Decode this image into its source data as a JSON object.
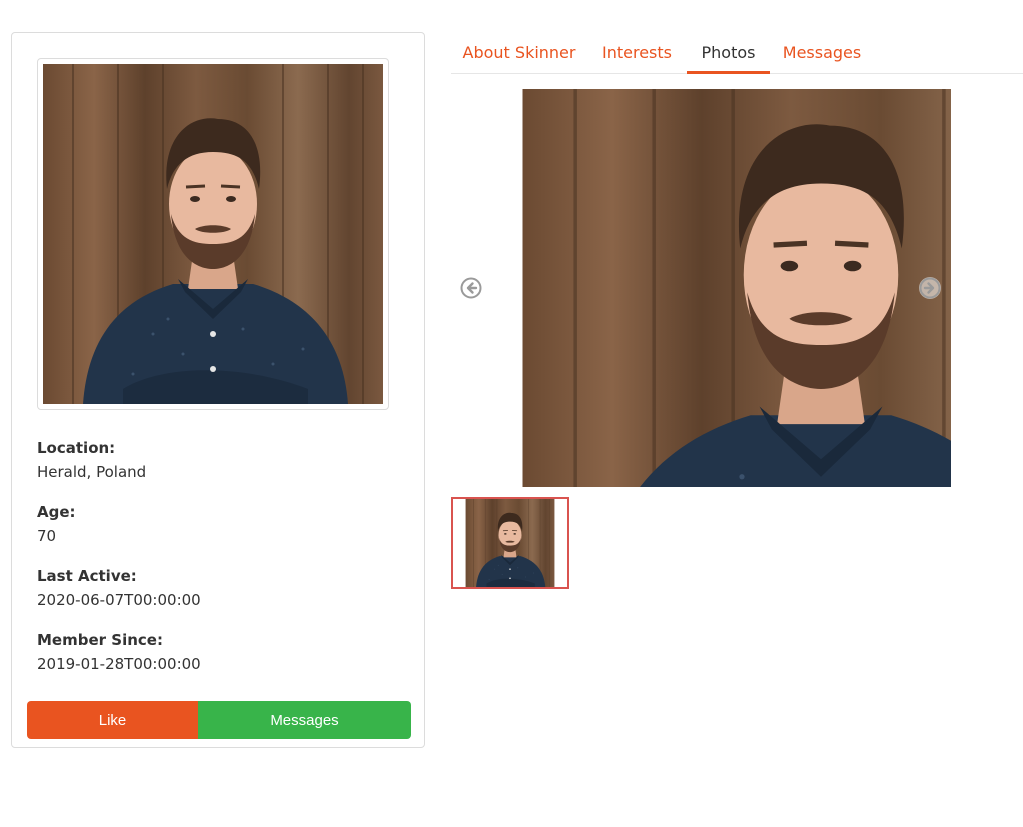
{
  "profile": {
    "photo": "profile-photo",
    "location": {
      "label": "Location:",
      "value": "Herald, Poland"
    },
    "age": {
      "label": "Age:",
      "value": "70"
    },
    "last_active": {
      "label": "Last Active:",
      "value": "2020-06-07T00:00:00"
    },
    "member_since": {
      "label": "Member Since:",
      "value": "2019-01-28T00:00:00"
    },
    "like_label": "Like",
    "messages_label": "Messages"
  },
  "tabs": [
    {
      "label": "About Skinner",
      "active": false
    },
    {
      "label": "Interests",
      "active": false
    },
    {
      "label": "Photos",
      "active": true
    },
    {
      "label": "Messages",
      "active": false
    }
  ],
  "gallery": {
    "prev_icon": "arrow-left-circle-icon",
    "next_icon": "arrow-right-circle-icon",
    "selected_index": 0
  },
  "colors": {
    "accent": "#e95420",
    "success": "#38b44a",
    "thumb_border": "#d9534f"
  }
}
